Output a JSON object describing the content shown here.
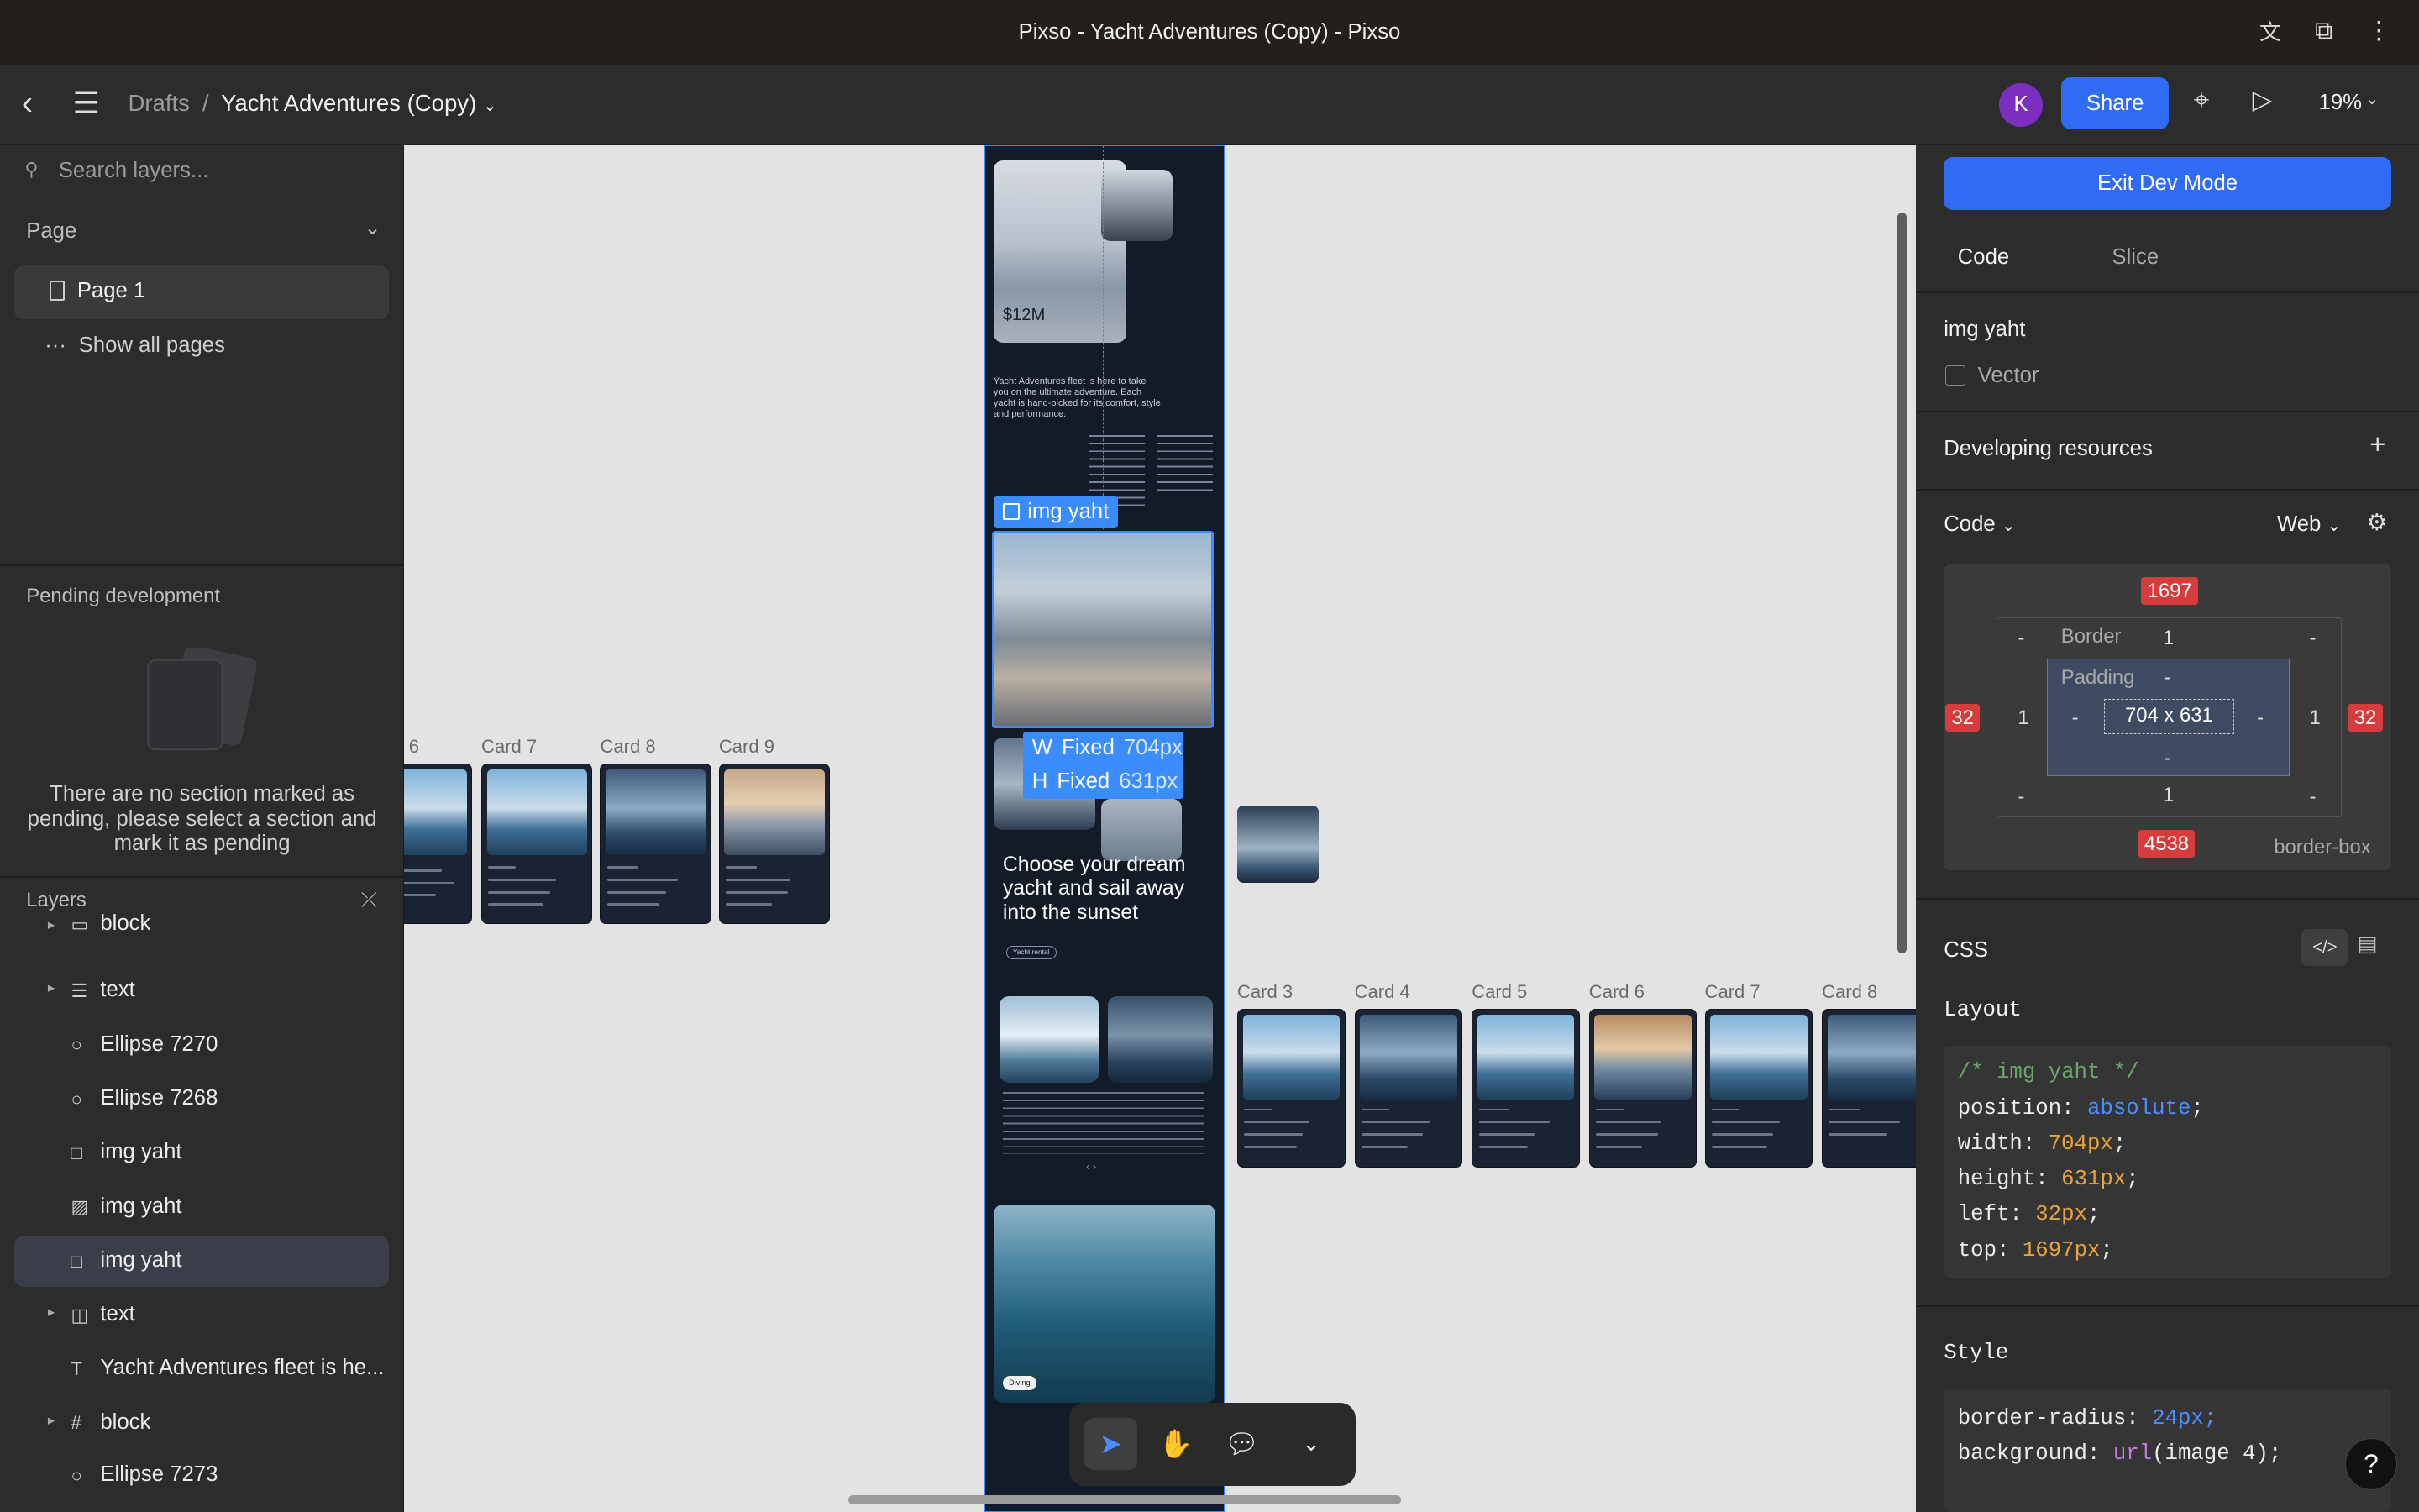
{
  "window": {
    "title": "Pixso - Yacht Adventures (Copy) - Pixso"
  },
  "toolbar": {
    "breadcrumb_root": "Drafts",
    "separator": "/",
    "file_name": "Yacht Adventures (Copy)",
    "avatar_letter": "K",
    "share_label": "Share",
    "zoom": "19%"
  },
  "left_panel": {
    "search_placeholder": "Search layers...",
    "page_section": "Page",
    "current_page": "Page 1",
    "show_all_pages": "Show all pages",
    "pending_title": "Pending development",
    "pending_message": "There are no section marked as pending, please select a section and mark it as pending",
    "layers_title": "Layers",
    "layers": [
      {
        "label": "block",
        "icon": "frame-group-icon",
        "caret": true
      },
      {
        "label": "text",
        "icon": "stack-icon",
        "caret": true
      },
      {
        "label": "Ellipse 7270",
        "icon": "ellipse-icon",
        "caret": false
      },
      {
        "label": "Ellipse 7268",
        "icon": "ellipse-icon",
        "caret": false
      },
      {
        "label": "img yaht",
        "icon": "rectangle-icon",
        "caret": false
      },
      {
        "label": "img yaht",
        "icon": "image-icon",
        "caret": false
      },
      {
        "label": "img yaht",
        "icon": "rectangle-icon",
        "caret": false,
        "selected": true
      },
      {
        "label": "text",
        "icon": "columns-icon",
        "caret": true
      },
      {
        "label": "Yacht Adventures fleet is he...",
        "icon": "text-icon",
        "caret": false
      },
      {
        "label": "block",
        "icon": "frame-icon",
        "caret": true
      },
      {
        "label": "Ellipse 7273",
        "icon": "ellipse-icon",
        "caret": false
      }
    ]
  },
  "canvas": {
    "row1_labels": [
      "6",
      "Card 7",
      "Card 8",
      "Card 9"
    ],
    "row2_labels": [
      "Card 3",
      "Card 4",
      "Card 5",
      "Card 6",
      "Card 7",
      "Card 8"
    ],
    "frame": {
      "price": "$12M",
      "intro": "Yacht Adventures fleet is here to take you on the ultimate adventure. Each yacht is hand-picked for its comfort, style, and performance.",
      "headline": "Choose your dream yacht and sail away into the sunset",
      "pill": "Yacht rental",
      "diving_pill": "Diving"
    },
    "selection_label": "img yaht",
    "dim_w_key": "W",
    "dim_w_mode": "Fixed",
    "dim_w_value": "704px",
    "dim_h_key": "H",
    "dim_h_mode": "Fixed",
    "dim_h_value": "631px"
  },
  "right_panel": {
    "exit_label": "Exit Dev Mode",
    "tabs": [
      "Code",
      "Slice"
    ],
    "layer_name": "img yaht",
    "layer_type": "Vector",
    "dev_resources": "Developing resources",
    "code_dropdown": "Code",
    "platform_dropdown": "Web",
    "box": {
      "top": "1697",
      "bottom": "4538",
      "left": "32",
      "right": "32",
      "border_label": "Border",
      "border_top": "1",
      "border_bottom": "1",
      "border_left": "1",
      "border_right": "1",
      "margin_dash": "-",
      "padding_label": "Padding",
      "padding_dash": "-",
      "size": "704 x 631",
      "box_sizing": "border-box"
    },
    "css_title": "CSS",
    "layout_title": "Layout",
    "code_lines": {
      "comment": "/* img yaht */",
      "position_key": "position:",
      "position_val": "absolute",
      "width_key": "width:",
      "width_val": "704px",
      "height_key": "height:",
      "height_val": "631px",
      "left_key": "left:",
      "left_val": "32px",
      "top_key": "top:",
      "top_val": "1697px"
    },
    "style_title": "Style",
    "style_lines": {
      "radius_key": "border-radius:",
      "radius_val": "24px;",
      "bg_key": "background:",
      "bg_fn": "url",
      "bg_arg": "(image 4);"
    }
  },
  "colors": {
    "accent": "#2f6bf5",
    "selection": "#3b8cff",
    "measure_red": "#d63c3c"
  }
}
